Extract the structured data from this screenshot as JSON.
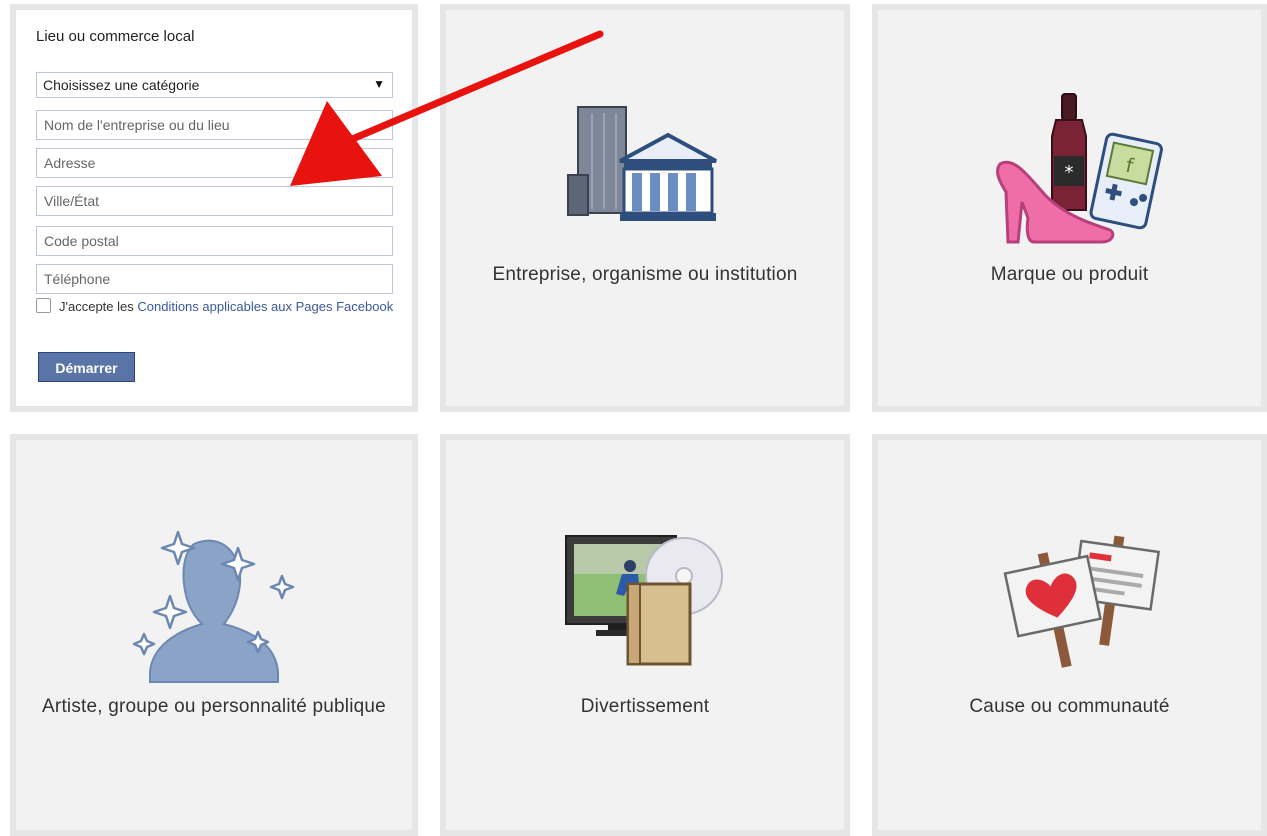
{
  "form": {
    "title": "Lieu ou commerce local",
    "category_select": {
      "value": "Choisissez une catégorie",
      "arrow": "▼"
    },
    "fields": [
      {
        "placeholder": "Nom de l'entreprise ou du lieu"
      },
      {
        "placeholder": "Adresse"
      },
      {
        "placeholder": "Ville/État"
      },
      {
        "placeholder": "Code postal"
      },
      {
        "placeholder": "Téléphone"
      }
    ],
    "terms_text": "J'accepte les ",
    "terms_link": "Conditions applicables aux Pages Facebook",
    "submit_label": "Démarrer"
  },
  "tiles": [
    {
      "label": "Entreprise, organisme ou institution",
      "icon": "buildings-icon"
    },
    {
      "label": "Marque ou produit",
      "icon": "products-icon"
    },
    {
      "label": "Artiste, groupe ou personnalité publique",
      "icon": "public-figure-icon"
    },
    {
      "label": "Divertissement",
      "icon": "entertainment-icon"
    },
    {
      "label": "Cause ou communauté",
      "icon": "cause-icon"
    }
  ],
  "colors": {
    "tile_bg": "#f2f2f2",
    "tile_border": "#e6e6e6",
    "brand_blue": "#3b5998",
    "button_blue": "#5b74a8",
    "arrow_red": "#e8120f"
  }
}
